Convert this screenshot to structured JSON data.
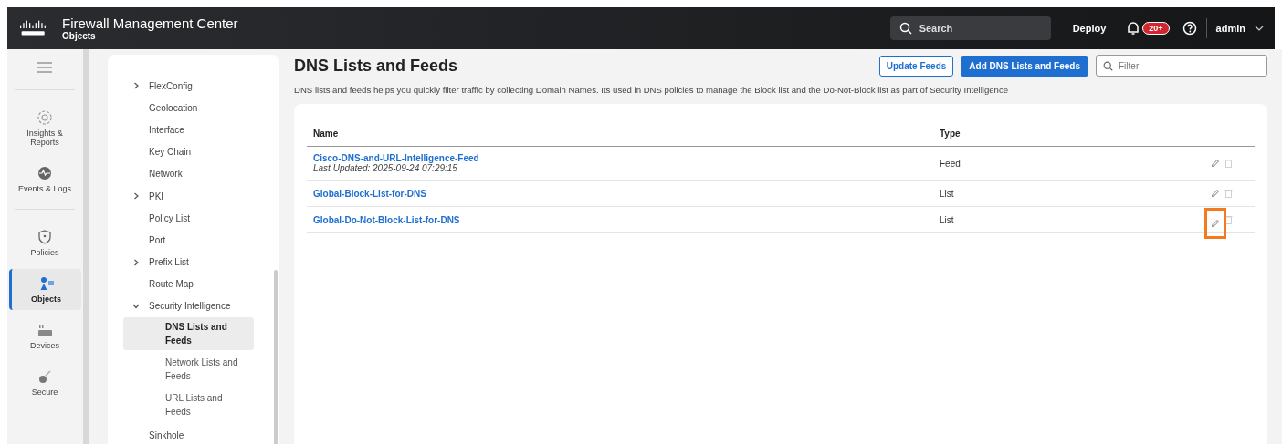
{
  "header": {
    "product": "Firewall Management Center",
    "section": "Objects",
    "search": {
      "placeholder": "Search"
    },
    "deploy": "Deploy",
    "notifications": "20+",
    "user": "admin"
  },
  "rail": [
    {
      "label": "Insights & Reports",
      "selected": false
    },
    {
      "label": "Events & Logs",
      "selected": false
    },
    {
      "label": "Policies",
      "selected": false
    },
    {
      "label": "Objects",
      "selected": true
    },
    {
      "label": "Devices",
      "selected": false
    },
    {
      "label": "Secure",
      "selected": false
    }
  ],
  "tree": [
    {
      "label": "FlexConfig",
      "expandable": true,
      "expanded": false
    },
    {
      "label": "Geolocation",
      "expandable": false,
      "expanded": false
    },
    {
      "label": "Interface",
      "expandable": false,
      "expanded": false
    },
    {
      "label": "Key Chain",
      "expandable": false,
      "expanded": false
    },
    {
      "label": "Network",
      "expandable": false,
      "expanded": false
    },
    {
      "label": "PKI",
      "expandable": true,
      "expanded": false
    },
    {
      "label": "Policy List",
      "expandable": false,
      "expanded": false
    },
    {
      "label": "Port",
      "expandable": false,
      "expanded": false
    },
    {
      "label": "Prefix List",
      "expandable": true,
      "expanded": false
    },
    {
      "label": "Route Map",
      "expandable": false,
      "expanded": false
    },
    {
      "label": "Security Intelligence",
      "expandable": true,
      "expanded": true,
      "children": [
        {
          "label": "DNS Lists and Feeds",
          "selected": true
        },
        {
          "label": "Network Lists and Feeds",
          "selected": false
        },
        {
          "label": "URL Lists and Feeds",
          "selected": false
        }
      ]
    },
    {
      "label": "Sinkhole",
      "expandable": false,
      "expanded": false
    }
  ],
  "page": {
    "title": "DNS Lists and Feeds",
    "update_button": "Update Feeds",
    "add_button": "Add DNS Lists and Feeds",
    "filter": {
      "placeholder": "Filter"
    },
    "description": "DNS lists and feeds helps you quickly filter traffic by collecting Domain Names. Its used in DNS policies to manage the Block list and the Do-Not-Block list as part of Security Intelligence"
  },
  "table": {
    "columns": [
      "Name",
      "Type"
    ],
    "rows": [
      {
        "name": "Cisco-DNS-and-URL-Intelligence-Feed",
        "updated": "Last Updated: 2025-09-24 07:29:15",
        "type": "Feed",
        "highlighted": false
      },
      {
        "name": "Global-Block-List-for-DNS",
        "type": "List",
        "highlighted": false
      },
      {
        "name": "Global-Do-Not-Block-List-for-DNS",
        "type": "List",
        "highlighted": true
      }
    ]
  }
}
